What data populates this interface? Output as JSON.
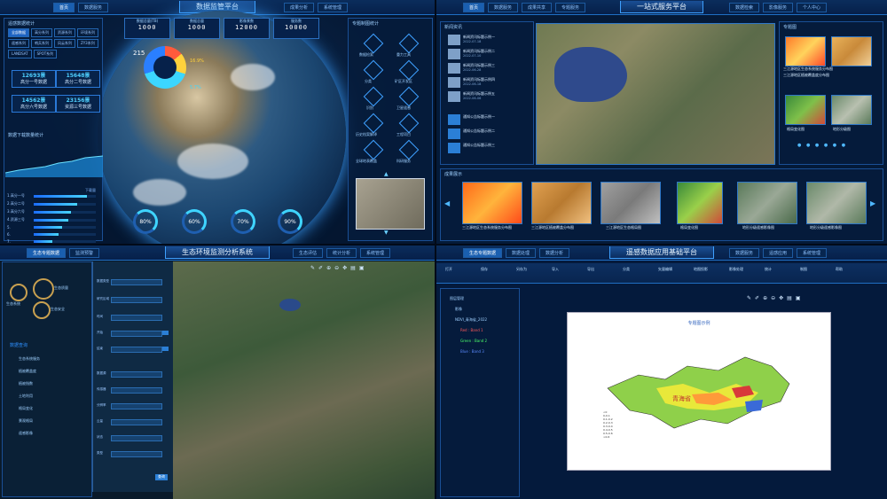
{
  "panel1": {
    "title": "数据监管平台",
    "nav_left": [
      "首页",
      "数据服务"
    ],
    "nav_right": [
      "成果分析",
      "系统管理"
    ],
    "counters": [
      {
        "label": "数据总量(TB)",
        "value": "1000"
      },
      {
        "label": "数据总量",
        "value": "1000"
      },
      {
        "label": "影像景数",
        "value": "12000"
      },
      {
        "label": "服务数",
        "value": "10000"
      }
    ],
    "left_section_title": "遥感数据统计",
    "tabs": [
      "全部数据",
      "高分系列",
      "资源系列",
      "环境系列",
      "遥感系列",
      "哨兵系列",
      "风云系列",
      "ZY3系列",
      "LANDSAT",
      "SPOT系列"
    ],
    "stats": [
      {
        "value": "12693景",
        "label": "高分一号数据"
      },
      {
        "value": "15648景",
        "label": "高分二号数据"
      },
      {
        "value": "14562景",
        "label": "高分六号数据"
      },
      {
        "value": "23156景",
        "label": "资源三号数据"
      }
    ],
    "chart_title": "数据下载数量统计",
    "bar_legend": "下载量",
    "bar_items": [
      {
        "label": "1.高分一号",
        "value": 0.85
      },
      {
        "label": "2.高分二号",
        "value": 0.7
      },
      {
        "label": "3.高分六号",
        "value": 0.6
      },
      {
        "label": "4.资源三号",
        "value": 0.55
      },
      {
        "label": "5.",
        "value": 0.45
      },
      {
        "label": "6.",
        "value": 0.4
      },
      {
        "label": "7.",
        "value": 0.3
      }
    ],
    "donut_total": "215",
    "donut_labels": [
      "16.9%",
      "5.7%"
    ],
    "gauges": [
      "80%",
      "60%",
      "70%",
      "90%"
    ],
    "right_section_title": "专题制图统计",
    "right_icons": [
      "数据检索",
      "重力工具",
      "分类",
      "矿区开发区",
      "识别",
      "卫星遥感",
      "历史档案解译",
      "工程项目",
      "全球地表覆盖",
      "科研服务"
    ]
  },
  "panel2": {
    "title": "一站式服务平台",
    "nav_left": [
      "首页",
      "数据服务",
      "成果共享",
      "专题服务"
    ],
    "nav_right": [
      "数据检索",
      "影像服务",
      "个人中心"
    ],
    "news_title": "新闻资讯",
    "news": [
      {
        "title": "新闻资讯标题示例一",
        "date": "2022-07-18"
      },
      {
        "title": "新闻资讯标题示例二",
        "date": "2022-07-10"
      },
      {
        "title": "新闻资讯标题示例三",
        "date": "2022-06-28"
      },
      {
        "title": "新闻资讯标题示例四",
        "date": "2022-06-18"
      },
      {
        "title": "新闻资讯标题示例五",
        "date": "2022-06-06"
      }
    ],
    "notices": [
      "通知公告标题示例一",
      "通知公告标题示例二",
      "通知公告标题示例三"
    ],
    "thematic_title": "专题图",
    "thematic_items": [
      "三江源地区生态系统服务分布图",
      "三江源地区植被覆盖度分布图",
      "格局变化图",
      "地形分级图"
    ],
    "bottom_title": "成果展示",
    "bottom_items": [
      "三江源地区生态系统服务分布图",
      "三江源地区植被覆盖分布图",
      "三江源地区生态格局图",
      "格局变化图",
      "地形分级遥感影像图",
      "地形分级遥感影像图"
    ]
  },
  "panel3": {
    "title": "生态环境监测分析系统",
    "nav_left": [
      "生态专题数据",
      "监测预警"
    ],
    "nav_right": [
      "生态评估",
      "统计分析",
      "系统管理"
    ],
    "menu_icons": [
      "生态系统",
      "生态质量",
      "生态安全"
    ],
    "menu_title": "数据查询",
    "menu_items": [
      "生态系统服务",
      "植被覆盖度",
      "植被指数",
      "土地利用",
      "格局变化",
      "景观格局",
      "遥感影像"
    ],
    "form_labels": [
      "数据类型",
      "研究区域",
      "时间",
      "开始",
      "结束",
      "数据源",
      "传感器",
      "分辨率",
      "云量",
      "状态",
      "类型",
      "查询"
    ],
    "toolbar_icons": [
      "measure-icon",
      "draw-icon",
      "zoom-in-icon",
      "zoom-out-icon",
      "pan-icon",
      "layer-icon",
      "print-icon"
    ]
  },
  "panel4": {
    "title": "遥感数据应用基础平台",
    "nav_left": [
      "生态专题数据",
      "数据处理",
      "数据分析"
    ],
    "nav_right": [
      "数据服务",
      "遥感应用",
      "系统管理"
    ],
    "ribbon": [
      "打开",
      "保存",
      "另存为",
      "导入",
      "导出",
      "分类",
      "矢量编辑",
      "地图投影",
      "影像处理",
      "统计",
      "制图",
      "帮助"
    ],
    "tree": [
      "图层管理",
      "影像",
      "NDVI_青海省_2022",
      "Red : Band 1",
      "Green : Band 2",
      "Blue : Band 3"
    ],
    "map_title": "专题图示例",
    "province_label": "青海省",
    "legend": [
      "<0",
      "0-0.1",
      "0.1-0.2",
      "0.2-0.3",
      "0.3-0.4",
      "0.4-0.5",
      "0.5-0.6",
      ">0.6"
    ]
  }
}
